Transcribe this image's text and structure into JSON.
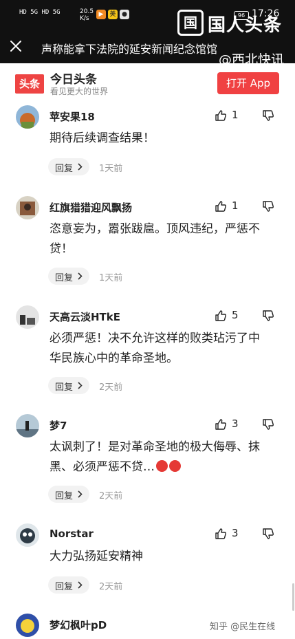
{
  "status_bar": {
    "signal": "HD 5G HD 5G",
    "speed_top": "20.5",
    "speed_unit": "K/s",
    "app_badge_2": "美",
    "battery": "96",
    "time": "17:26"
  },
  "watermark_top": {
    "badge": "国",
    "text": "国人头条"
  },
  "nav": {
    "title": "声称能拿下法院的延安新闻纪念馆馆",
    "watermark": "@西北快讯"
  },
  "banner": {
    "logo_text": "头条",
    "app_name": "今日头条",
    "slogan": "看见更大的世界",
    "open_button": "打开 App"
  },
  "comments": [
    {
      "user": "苹安果18",
      "likes": "1",
      "lines": [
        "期待后续调查结果！"
      ],
      "reply_label": "回复",
      "time": "1天前"
    },
    {
      "user": "红旗猎猎迎风飘扬",
      "likes": "1",
      "lines": [
        "恣意妄为，嚣张跋扈。顶风违纪，严惩不",
        "贷！"
      ],
      "reply_label": "回复",
      "time": "1天前"
    },
    {
      "user": "天高云淡HTkE",
      "likes": "5",
      "lines": [
        "必须严惩！决不允许这样的败类玷污了中",
        "华民族心中的革命圣地。"
      ],
      "reply_label": "回复",
      "time": "2天前"
    },
    {
      "user": "梦7",
      "likes": "3",
      "lines": [
        "太讽刺了！是对革命圣地的极大侮辱、抹",
        "黑、必须严惩不贷…"
      ],
      "reply_label": "回复",
      "time": "2天前"
    },
    {
      "user": "Norstar",
      "likes": "3",
      "lines": [
        "大力弘扬延安精神"
      ],
      "reply_label": "回复",
      "time": "2天前"
    },
    {
      "user": "梦幻枫叶pD",
      "likes": "",
      "lines": [],
      "reply_label": "",
      "time": ""
    }
  ],
  "footer_watermark": "知乎 @民生在线"
}
